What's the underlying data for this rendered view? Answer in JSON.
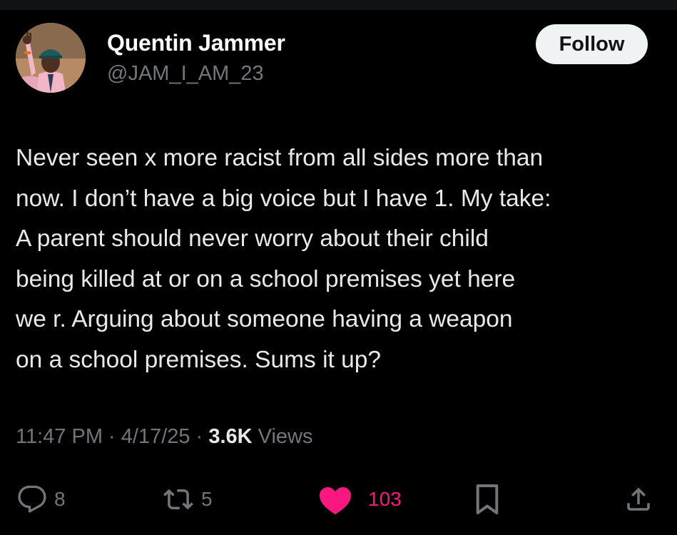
{
  "author": {
    "name": "Quentin Jammer",
    "handle": "@JAM_I_AM_23"
  },
  "follow_label": "Follow",
  "tweet": {
    "lines": [
      "Never seen x more racist from all sides more than",
      "now. I don’t have a big voice but I have 1. My take:",
      "A parent should never worry about their child",
      "being killed at or on a school premises yet here",
      "we r. Arguing about someone having a weapon",
      "on a school premises. Sums it up?"
    ]
  },
  "meta": {
    "time": "11:47 PM",
    "sep1": " · ",
    "date": "4/17/25",
    "sep2": " · ",
    "views_count": "3.6K",
    "views_label": " Views"
  },
  "actions": {
    "replies": "8",
    "reposts": "5",
    "likes": "103"
  },
  "icons": {
    "reply": "reply-icon",
    "repost": "repost-icon",
    "like": "heart-icon",
    "bookmark": "bookmark-icon",
    "share": "share-icon"
  },
  "colors": {
    "background": "#000000",
    "text": "#e7e9ea",
    "secondary": "#71767b",
    "like": "#f91880",
    "follow_bg": "#eff3f4"
  }
}
